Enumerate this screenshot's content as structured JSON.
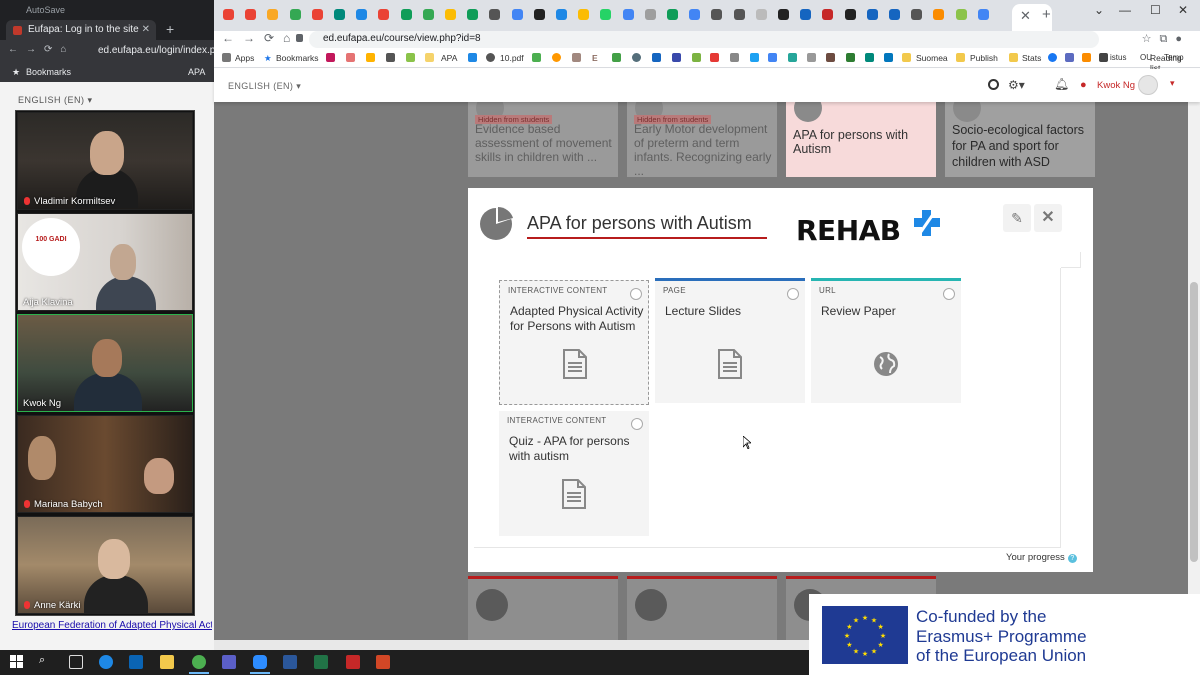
{
  "back_window": {
    "autosave": "AutoSave",
    "tab_title": "Eufapa: Log in to the site",
    "url": "ed.eufapa.eu/login/index.p",
    "bookmarks": [
      "Bookmarks",
      "APA"
    ],
    "language": "ENGLISH (EN)",
    "footer_link": "European Federation of Adapted Physical Activit"
  },
  "participants": [
    {
      "name": "Vladimir Kormiltsev",
      "muted": true
    },
    {
      "name": "Aija Klavina",
      "muted": false,
      "logo_text": "100 GADI"
    },
    {
      "name": "Kwok Ng",
      "muted": false,
      "speaking": true
    },
    {
      "name": "Mariana Babych",
      "muted": true
    },
    {
      "name": "Anne Kärki",
      "muted": true
    }
  ],
  "browser": {
    "url": "ed.eufapa.eu/course/view.php?id=8",
    "bookmarks": [
      "Apps",
      "Bookmarks",
      "APA",
      "10.pdf",
      "E",
      "Suomea",
      "Publish",
      "Stats",
      "istus",
      "OU",
      "Temp"
    ],
    "bookmarks_right": "Reading list"
  },
  "moodle": {
    "language": "ENGLISH (EN)",
    "user_name": "Kwok Ng",
    "notification_count": "1"
  },
  "background_sections": [
    {
      "hidden_label": "Hidden from students",
      "title": "Evidence based assessment of movement skills in children with ..."
    },
    {
      "hidden_label": "Hidden from students",
      "title": "Early Motor development of preterm and term infants. Recognizing early ..."
    },
    {
      "title": "APA for persons with Autism"
    },
    {
      "title": "Socio-ecological factors for PA and sport for children with ASD"
    }
  ],
  "modal": {
    "title": "APA for persons with Autism",
    "logo_text": "REHAB",
    "edit_label": "✎",
    "close_label": "✕",
    "activities": [
      {
        "type": "INTERACTIVE CONTENT",
        "name": "Adapted Physical Activity for Persons with Autism",
        "icon": "document-icon"
      },
      {
        "type": "PAGE",
        "name": "Lecture Slides",
        "icon": "document-icon"
      },
      {
        "type": "URL",
        "name": "Review Paper",
        "icon": "globe-icon"
      },
      {
        "type": "INTERACTIVE CONTENT",
        "name": "Quiz - APA for persons with autism",
        "icon": "document-icon"
      }
    ],
    "progress_label": "Your progress"
  },
  "eu_banner": {
    "line1": "Co-funded by the",
    "line2": "Erasmus+ Programme",
    "line3": "of the European Union"
  },
  "colors": {
    "accent_red": "#b71c1c",
    "page_blue": "#2a6ebb",
    "url_teal": "#26b5b2",
    "eu_blue": "#1f3a93"
  }
}
